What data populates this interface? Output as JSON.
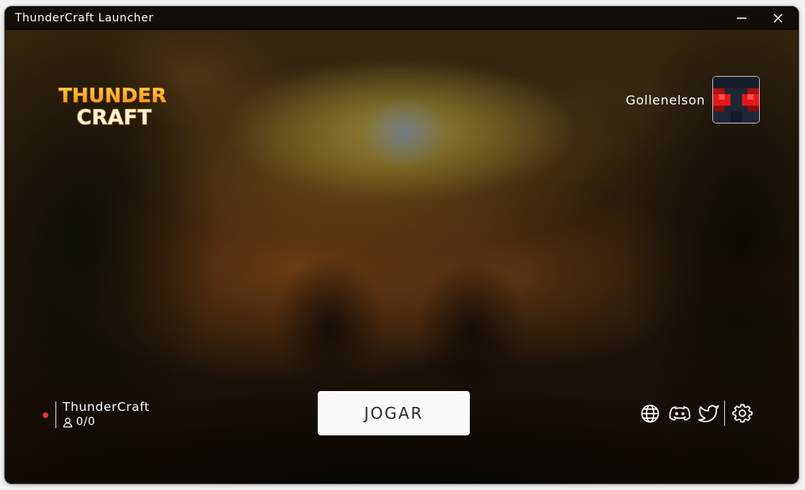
{
  "window": {
    "title": "ThunderCraft Launcher",
    "minimize_icon": "minimize-icon",
    "close_icon": "close-icon"
  },
  "logo": {
    "line1": "THUNDER",
    "line2": "CRAFT",
    "colors": [
      "#f5a623",
      "#ffd54f",
      "#ffffff"
    ]
  },
  "account": {
    "username": "Gollenelson",
    "avatar_colors": [
      "#1d2535",
      "#e01515"
    ]
  },
  "server": {
    "name": "ThunderCraft",
    "players": "0/0",
    "status_color": "#e53935",
    "player_icon": "user-icon"
  },
  "play": {
    "label": "JOGAR"
  },
  "social": {
    "icons": [
      "globe-icon",
      "discord-icon",
      "twitter-icon"
    ],
    "settings_icon": "gear-icon"
  }
}
